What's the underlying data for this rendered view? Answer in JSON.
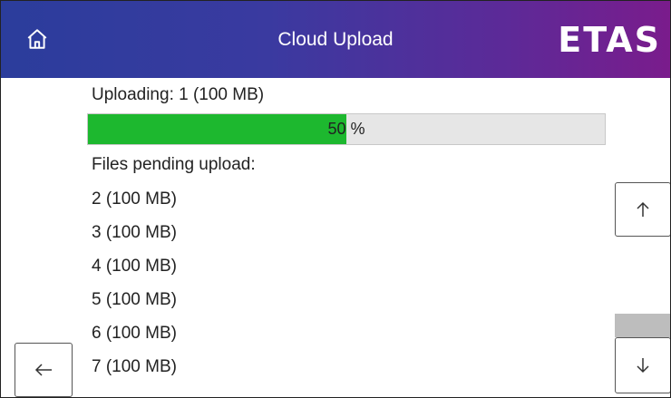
{
  "header": {
    "title": "Cloud Upload",
    "logo_text": "ETAS"
  },
  "upload": {
    "label": "Uploading: 1 (100 MB)",
    "progress_percent": 50,
    "progress_number": "50",
    "progress_unit": " %"
  },
  "pending": {
    "label": "Files pending upload:",
    "files": [
      "2 (100 MB)",
      "3 (100 MB)",
      "4 (100 MB)",
      "5 (100 MB)",
      "6 (100 MB)",
      "7 (100 MB)"
    ]
  },
  "icons": {
    "home": "home-icon",
    "back": "arrow-left-icon",
    "up": "arrow-up-icon",
    "down": "arrow-down-icon"
  },
  "colors": {
    "header_start": "#2b3d9c",
    "header_end": "#7a1c8c",
    "progress_fill": "#1db82f",
    "progress_track": "#e6e6e6"
  }
}
